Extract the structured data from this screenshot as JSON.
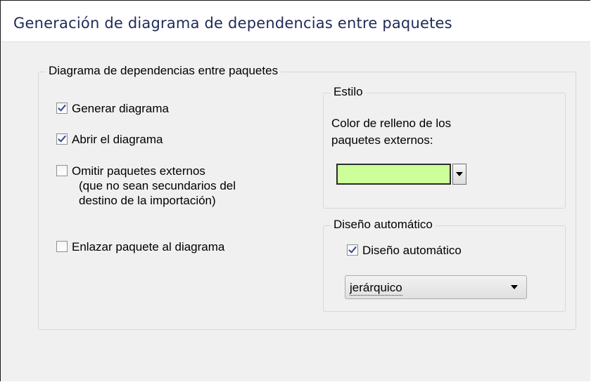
{
  "window": {
    "title": "Generación de diagrama de dependencias entre paquetes"
  },
  "main_group": {
    "legend": "Diagrama de dependencias entre paquetes",
    "options": [
      {
        "label": "Generar diagrama",
        "checked": true
      },
      {
        "label": "Abrir el diagrama",
        "checked": true
      },
      {
        "label": "Omitir paquetes externos",
        "sublabel_1": "(que no sean secundarios del",
        "sublabel_2": "destino de la importación)",
        "checked": false
      },
      {
        "label": "Enlazar paquete al diagrama",
        "checked": false
      }
    ]
  },
  "style_group": {
    "legend": "Estilo",
    "fill_label_1": "Color de relleno de los",
    "fill_label_2": "paquetes externos:",
    "fill_color": "#ccff99"
  },
  "layout_group": {
    "legend": "Diseño automático",
    "auto_layout": {
      "label": "Diseño automático",
      "checked": true
    },
    "layout_select": {
      "value": "jerárquico"
    }
  },
  "icons": {
    "checkbox_check": "check-mark",
    "dropdown": "chevron-down-icon"
  }
}
